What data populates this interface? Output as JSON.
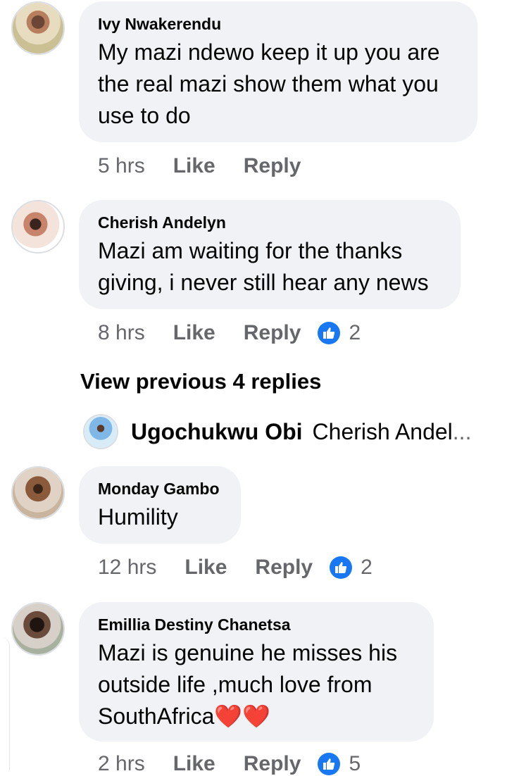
{
  "comments": [
    {
      "author": "Ivy Nwakerendu",
      "text": "My mazi ndewo keep it up you are\nthe real mazi show them what you\nuse to do",
      "time": "5 hrs",
      "like_label": "Like",
      "reply_label": "Reply",
      "reaction_count": null
    },
    {
      "author": "Cherish Andelyn",
      "text": "Mazi am waiting for the thanks\ngiving, i never still hear any news",
      "time": "8 hrs",
      "like_label": "Like",
      "reply_label": "Reply",
      "reaction_count": "2"
    },
    {
      "author": "Monday Gambo",
      "text": "Humility",
      "time": "12 hrs",
      "like_label": "Like",
      "reply_label": "Reply",
      "reaction_count": "2"
    },
    {
      "author": "Emillia Destiny Chanetsa",
      "text": "Mazi is genuine he misses his\noutside life ,much love from\nSouthAfrica❤️❤️",
      "time": "2 hrs",
      "like_label": "Like",
      "reply_label": "Reply",
      "reaction_count": "5"
    }
  ],
  "view_previous": "View previous 4 replies",
  "reply_preview": {
    "author": "Ugochukwu Obi",
    "text": "Cherish Andel",
    "ellipsis": "..."
  },
  "icons": {
    "reaction": "like-thumb-icon",
    "heart": "red-heart-icon"
  },
  "colors": {
    "bubble": "#f0f2f5",
    "meta": "#65676b",
    "like_blue": "#1877f2"
  }
}
